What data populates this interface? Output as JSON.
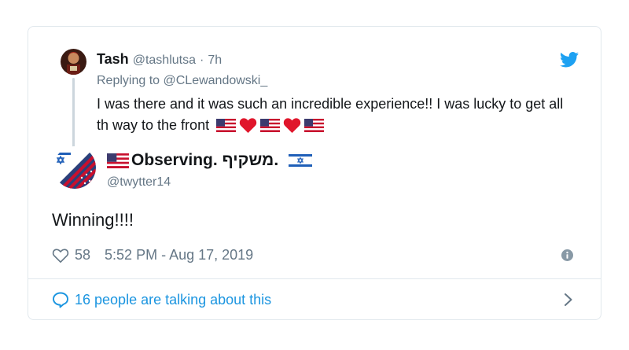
{
  "parent": {
    "name": "Tash",
    "handle": "@tashlutsa",
    "separator": "·",
    "time": "7h",
    "replying_prefix": "Replying to",
    "replying_handle": "@CLewandowski_",
    "text": "I was there and it was such an incredible experience!! I was lucky to get all th way to the front",
    "emojis": [
      "us-flag",
      "red-heart",
      "us-flag",
      "red-heart",
      "us-flag"
    ]
  },
  "tweet": {
    "name_text": "Observing. משקיף.",
    "handle": "@twytter14",
    "text": "Winning!!!!",
    "like_count": "58",
    "timestamp": "5:52 PM - Aug 17, 2019"
  },
  "footer": {
    "talking_text": "16 people are talking about this"
  },
  "icons": {
    "brand": "twitter-bird-icon",
    "like": "heart-outline-icon",
    "info": "info-icon",
    "comment": "speech-bubble-icon",
    "chevron": "chevron-right-icon"
  },
  "colors": {
    "twitter_blue": "#1da1f2",
    "link_blue": "#1b95e0",
    "muted": "#657786",
    "text": "#14171a",
    "border": "#e1e8ed"
  }
}
